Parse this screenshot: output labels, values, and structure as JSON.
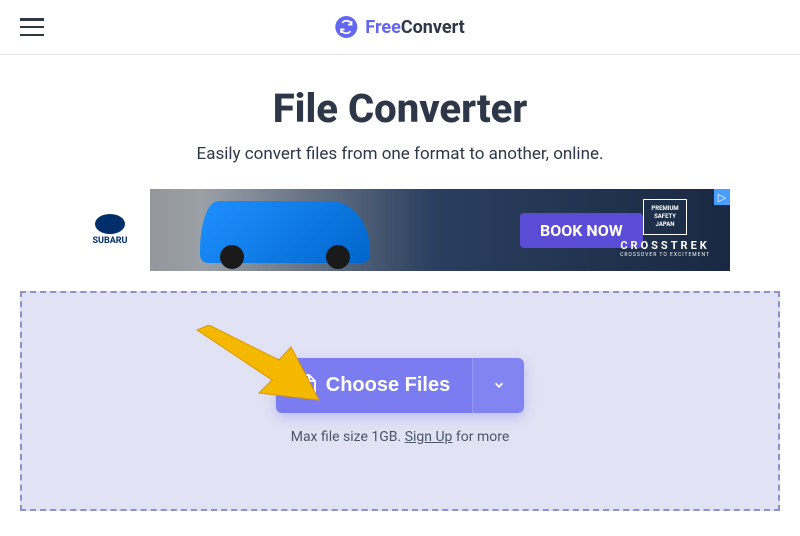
{
  "brand": {
    "part1": "Free",
    "part2": "Convert"
  },
  "hero": {
    "title": "File Converter",
    "subtitle": "Easily convert files from one format to another, online."
  },
  "ad": {
    "brand_small": "SUBARU",
    "cta": "BOOK NOW",
    "shield_line1": "PREMIUM",
    "shield_line2": "SAFETY",
    "shield_line3": "JAPAN",
    "model": "CROSSTREK",
    "tagline": "CROSSOVER TO EXCITEMENT"
  },
  "dropzone": {
    "choose_label": "Choose Files",
    "hint_prefix": "Max file size 1GB. ",
    "signup": "Sign Up",
    "hint_suffix": " for more"
  }
}
